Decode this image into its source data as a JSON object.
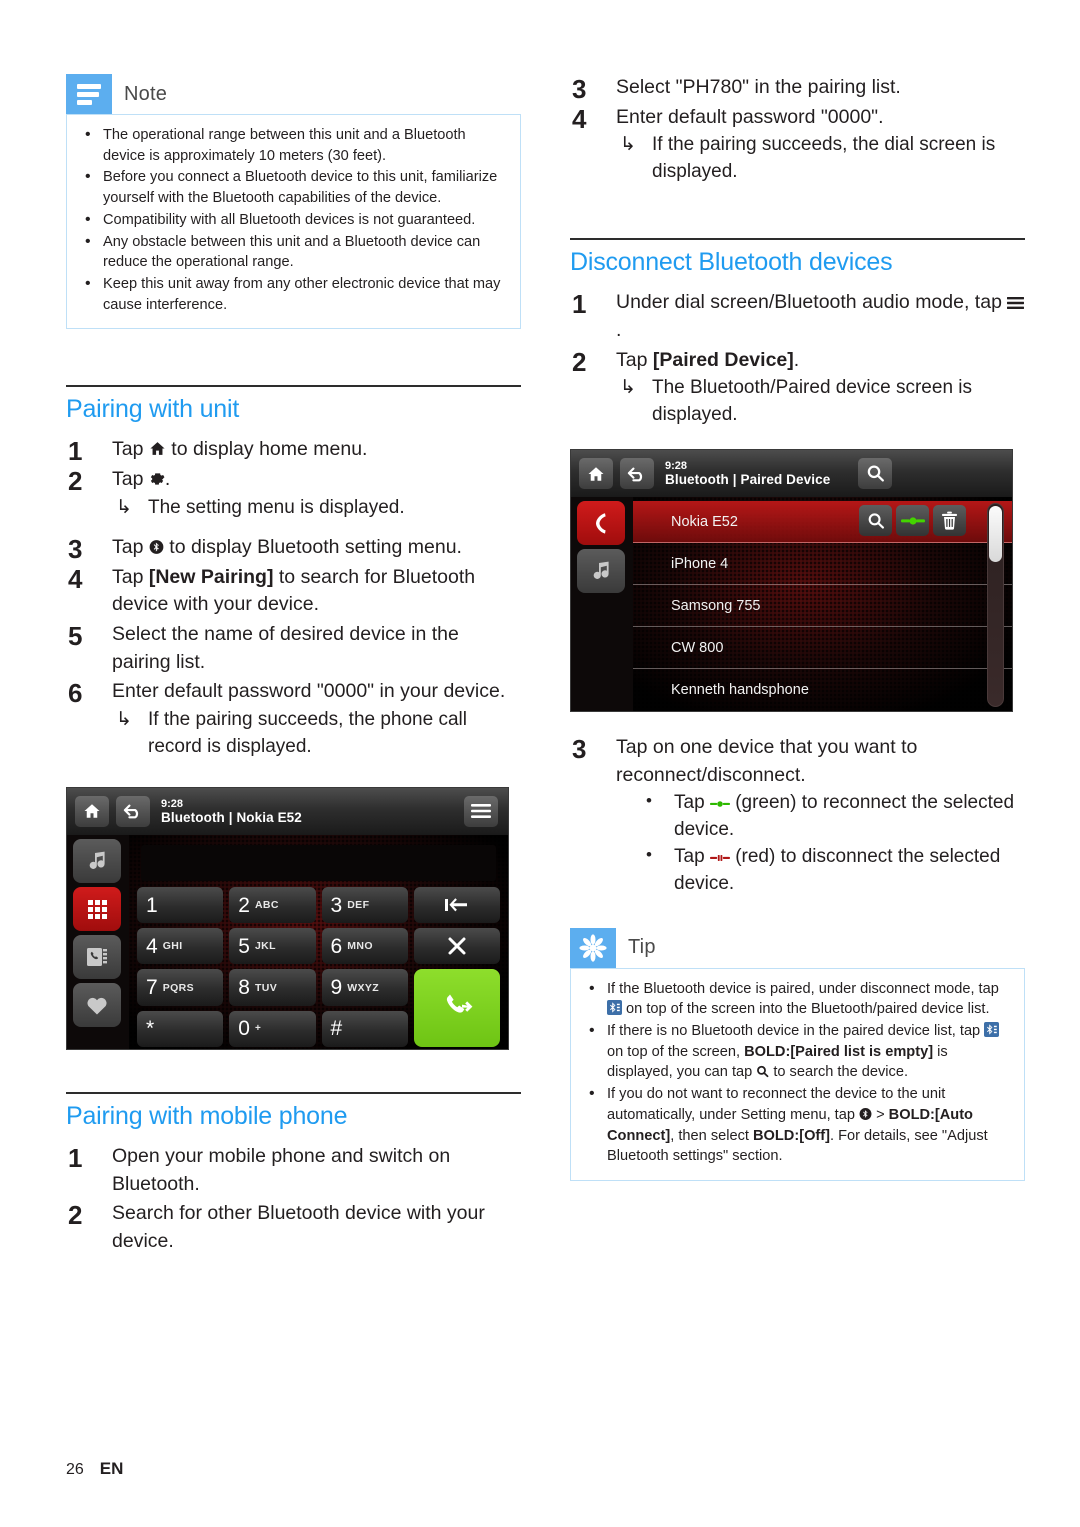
{
  "page": {
    "number": "26",
    "language": "EN"
  },
  "note": {
    "title": "Note",
    "icon": "note-lines-icon",
    "accent": "#5caeef",
    "items": [
      "The operational range between this unit and a Bluetooth device is approximately 10 meters (30 feet).",
      "Before you connect a Bluetooth device to this unit, familiarize yourself with the Bluetooth capabilities of the device.",
      "Compatibility with all Bluetooth devices is not guaranteed.",
      "Any obstacle between this unit and a Bluetooth device can reduce the operational range.",
      "Keep this unit away from any other electronic device that may cause interference."
    ]
  },
  "pairing_with_unit": {
    "heading": "Pairing with unit",
    "heading_color": "#1f9bf0",
    "steps": [
      {
        "num": "1",
        "pre": "Tap ",
        "icon": "home-icon",
        "post": " to display home menu."
      },
      {
        "num": "2",
        "pre": "Tap ",
        "icon": "gear-icon",
        "post": ".",
        "sub": "The setting menu is displayed."
      },
      {
        "num": "3",
        "pre": "Tap ",
        "icon": "bluetooth-icon",
        "post": " to display Bluetooth setting menu."
      },
      {
        "num": "4",
        "pre": "Tap ",
        "bold": "[New Pairing]",
        "post": " to search for Bluetooth device with your device."
      },
      {
        "num": "5",
        "text": "Select the name of desired device in the pairing list."
      },
      {
        "num": "6",
        "text": "Enter default password \"0000\" in your device.",
        "sub": "If the pairing succeeds, the phone call record is displayed."
      }
    ]
  },
  "dial_screen": {
    "caption": "dial-screen-screenshot",
    "header": {
      "time": "9:28",
      "title": "Bluetooth | Nokia E52",
      "home_icon": "home-icon",
      "back_icon": "back-arrow-icon",
      "menu_icon": "hamburger-menu-icon"
    },
    "sidebar": [
      {
        "icon": "music-note-icon",
        "active": false
      },
      {
        "icon": "dialpad-grid-icon",
        "active": true
      },
      {
        "icon": "call-log-icon",
        "active": false
      },
      {
        "icon": "heart-favorites-icon",
        "active": false
      }
    ],
    "display_value": "",
    "keys": [
      {
        "digit": "1",
        "letters": ""
      },
      {
        "digit": "2",
        "letters": "ABC"
      },
      {
        "digit": "3",
        "letters": "DEF"
      },
      {
        "digit": "4",
        "letters": "GHI"
      },
      {
        "digit": "5",
        "letters": "JKL"
      },
      {
        "digit": "6",
        "letters": "MNO"
      },
      {
        "digit": "7",
        "letters": "PQRS"
      },
      {
        "digit": "8",
        "letters": "TUV"
      },
      {
        "digit": "9",
        "letters": "WXYZ"
      },
      {
        "digit": "*",
        "letters": ""
      },
      {
        "digit": "0",
        "letters": "+"
      },
      {
        "digit": "#",
        "letters": ""
      }
    ],
    "action_keys": [
      {
        "icon": "backspace-icon"
      },
      {
        "icon": "clear-x-icon"
      },
      {
        "icon": "call-icon",
        "color": "#76d219"
      }
    ]
  },
  "pairing_with_mobile": {
    "heading": "Pairing with mobile phone",
    "steps": [
      {
        "num": "1",
        "text": "Open your mobile phone and switch on Bluetooth."
      },
      {
        "num": "2",
        "text": "Search for other Bluetooth device with your device."
      }
    ]
  },
  "right_continued": {
    "steps": [
      {
        "num": "3",
        "text": "Select \"PH780\" in the pairing list."
      },
      {
        "num": "4",
        "text": "Enter default password \"0000\".",
        "sub": "If the pairing succeeds, the dial screen is displayed."
      }
    ]
  },
  "disconnect": {
    "heading": "Disconnect Bluetooth devices",
    "steps": [
      {
        "num": "1",
        "pre": "Under dial screen/Bluetooth audio mode, tap ",
        "icon": "hamburger-menu-icon",
        "post": "."
      },
      {
        "num": "2",
        "pre": "Tap ",
        "bold": "[Paired Device]",
        "post": ".",
        "sub": "The Bluetooth/Paired device screen is displayed."
      },
      {
        "num": "3",
        "text": "Tap on one device that you want to reconnect/disconnect.",
        "bullets": [
          {
            "pre": "Tap ",
            "icon": "connect-green-icon",
            "post": " (green) to reconnect the selected device."
          },
          {
            "pre": "Tap ",
            "icon": "disconnect-red-icon",
            "post": " (red) to disconnect the selected device."
          }
        ]
      }
    ]
  },
  "paired_device_screen": {
    "caption": "paired-device-list-screenshot",
    "header": {
      "time": "9:28",
      "title": "Bluetooth | Paired Device",
      "home_icon": "home-icon",
      "back_icon": "back-arrow-icon",
      "search_icon": "search-icon"
    },
    "sidebar": [
      {
        "icon": "phone-handset-icon",
        "active": true
      },
      {
        "icon": "music-note-icon",
        "active": false
      }
    ],
    "devices": [
      {
        "name": "Nokia E52",
        "selected": true,
        "actions": [
          "search-icon",
          "connect-green-icon",
          "trash-icon"
        ]
      },
      {
        "name": "iPhone 4",
        "selected": false
      },
      {
        "name": "Samsong 755",
        "selected": false
      },
      {
        "name": "CW 800",
        "selected": false
      },
      {
        "name": "Kenneth handsphone",
        "selected": false
      }
    ],
    "scrollbar": {
      "thumb_position": "top"
    }
  },
  "tip": {
    "title": "Tip",
    "icon": "tip-asterisk-icon",
    "accent": "#5caeef",
    "items": [
      {
        "parts": [
          "If the Bluetooth device is paired, under disconnect mode, tap ",
          "ICON:bluetooth-list-icon",
          " on top of the screen into the Bluetooth/paired device list."
        ]
      },
      {
        "parts": [
          "If there is no Bluetooth device in the paired device list, tap ",
          "ICON:bluetooth-list-icon",
          " on top of the screen, ",
          "BOLD:[Paired list is empty]",
          " is displayed, you can tap ",
          "ICON:search-icon",
          " to search the device."
        ]
      },
      {
        "parts": [
          "If you do not want to reconnect the device to the unit automatically, under Setting menu, tap ",
          "ICON:bluetooth-icon",
          " > ",
          "BOLD:[Auto Connect]",
          ", then select ",
          "BOLD:[Off]",
          ". For details, see \"Adjust Bluetooth settings\" section."
        ]
      }
    ]
  }
}
